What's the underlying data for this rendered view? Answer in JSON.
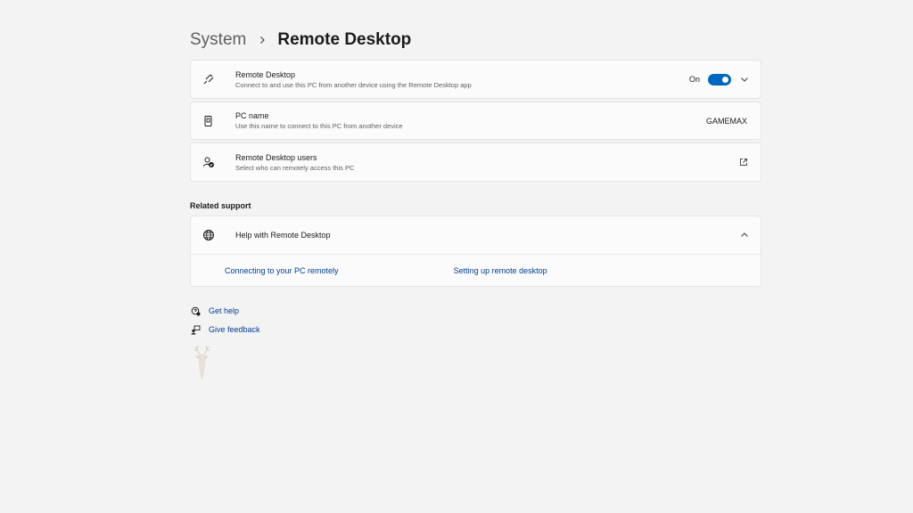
{
  "breadcrumb": {
    "parent": "System",
    "current": "Remote Desktop"
  },
  "remote_desktop": {
    "title": "Remote Desktop",
    "description": "Connect to and use this PC from another device using the Remote Desktop app",
    "toggle_label": "On",
    "toggle_state": "on",
    "icon": "remote-desktop-icon"
  },
  "pc_name": {
    "title": "PC name",
    "description": "Use this name to connect to this PC from another device",
    "value": "GAMEMAX",
    "icon": "pc-name-icon"
  },
  "rd_users": {
    "title": "Remote Desktop users",
    "description": "Select who can remotely access this PC",
    "icon": "users-icon"
  },
  "related_support": {
    "title": "Related support",
    "help": {
      "title": "Help with Remote Desktop",
      "links": [
        "Connecting to your PC remotely",
        "Setting up remote desktop"
      ]
    }
  },
  "footer": {
    "get_help": "Get help",
    "give_feedback": "Give feedback"
  },
  "colors": {
    "accent": "#0067c0",
    "link": "#003e92",
    "background": "#f3f3f3"
  }
}
